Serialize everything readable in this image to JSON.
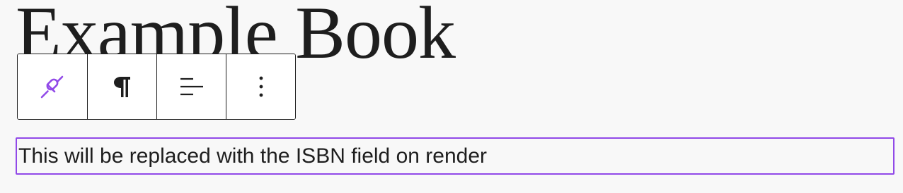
{
  "heading": {
    "title": "Example Book"
  },
  "toolbar": {
    "tools": [
      {
        "icon": "link-connected-icon",
        "color": "#9149e8"
      },
      {
        "icon": "paragraph-icon",
        "color": "#1e1e1e"
      },
      {
        "icon": "align-left-icon",
        "color": "#1e1e1e"
      },
      {
        "icon": "more-vertical-icon",
        "color": "#1e1e1e"
      }
    ]
  },
  "block": {
    "text": "This will be replaced with the ISBN field on render",
    "selected": true
  },
  "colors": {
    "accent": "#9149e8",
    "text": "#1e1e1e",
    "background": "#f8f8f8"
  }
}
